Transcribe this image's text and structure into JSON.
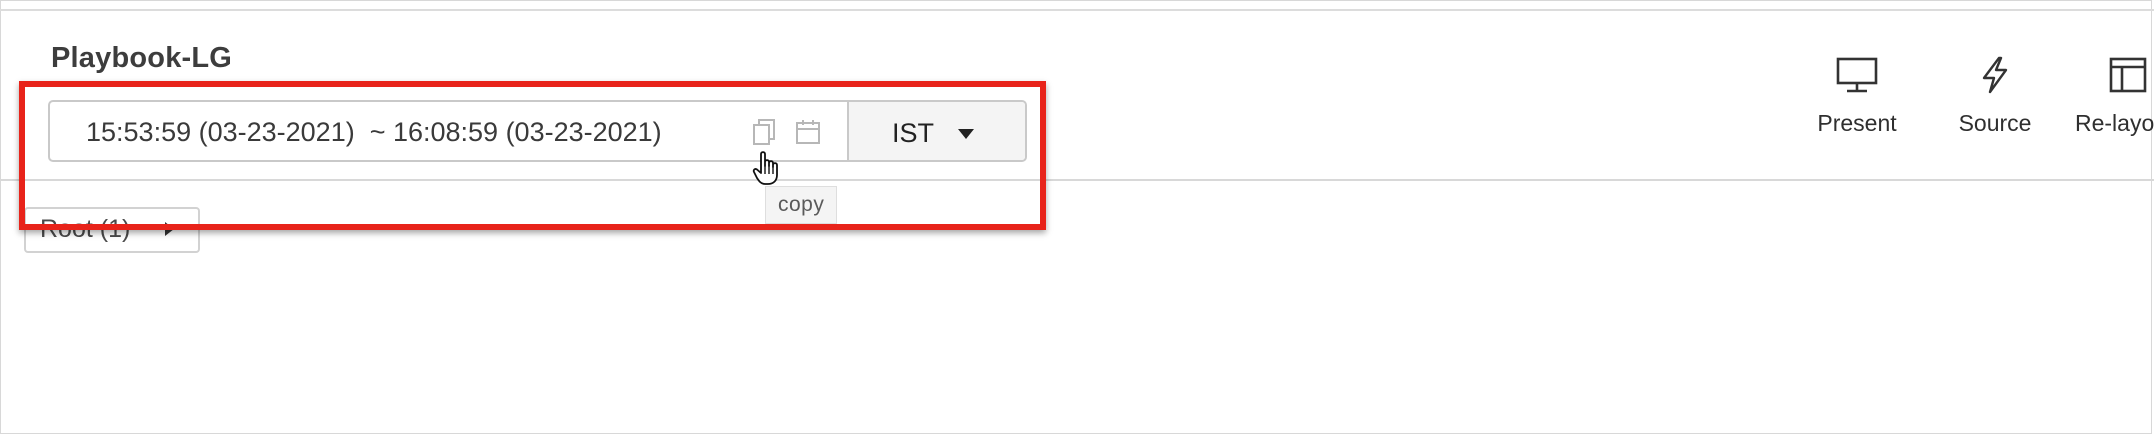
{
  "header": {
    "title": "Playbook-LG"
  },
  "time_range": {
    "text": "15:53:59 (03-23-2021)  ~ 16:08:59 (03-23-2021)",
    "copy_icon": "copy-icon",
    "calendar_icon": "calendar-icon",
    "timezone": "IST",
    "timezone_caret_icon": "caret-down-icon"
  },
  "tooltip": {
    "text": "copy"
  },
  "toolbar": {
    "present_label": "Present",
    "present_icon": "monitor-icon",
    "source_label": "Source",
    "source_icon": "lightning-icon",
    "relayout_label": "Re-layo",
    "relayout_icon": "layout-icon"
  },
  "breadcrumb": {
    "root_label": "Root (1)",
    "root_caret_icon": "caret-right-icon"
  },
  "colors": {
    "highlight": "#e8231a",
    "tooltip_bg": "#f4f4f4",
    "tz_button_bg": "#f4f4f4"
  }
}
